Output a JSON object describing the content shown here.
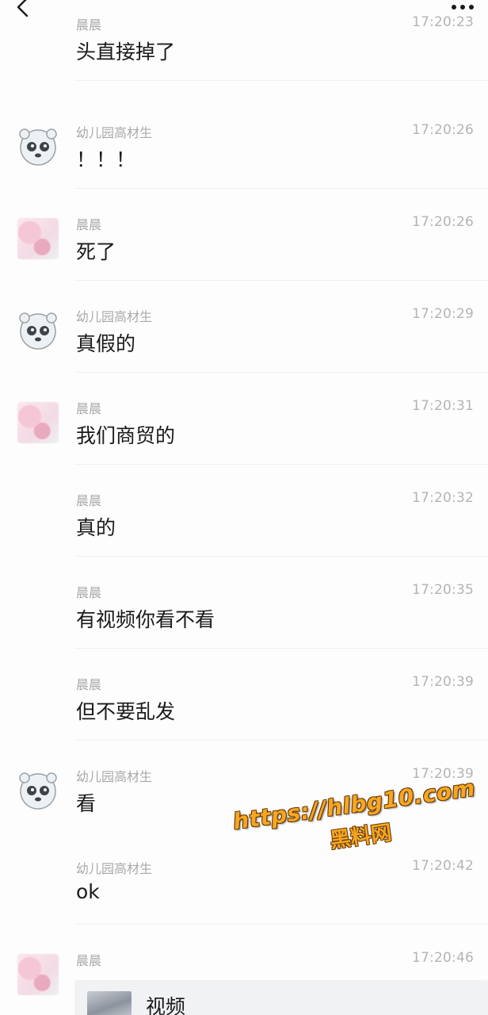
{
  "messages": [
    {
      "sender": "晨晨",
      "time": "17:20:23",
      "text": "头直接掉了",
      "avatar": "none"
    },
    {
      "sender": "幼儿园高材生",
      "time": "17:20:26",
      "text": "！！！",
      "avatar": "panda-avatar"
    },
    {
      "sender": "晨晨",
      "time": "17:20:26",
      "text": "死了",
      "avatar": "pink-avatar"
    },
    {
      "sender": "幼儿园高材生",
      "time": "17:20:29",
      "text": "真假的",
      "avatar": "panda-avatar"
    },
    {
      "sender": "晨晨",
      "time": "17:20:31",
      "text": "我们商贸的",
      "avatar": "pink-avatar"
    },
    {
      "sender": "晨晨",
      "time": "17:20:32",
      "text": "真的",
      "avatar": "none"
    },
    {
      "sender": "晨晨",
      "time": "17:20:35",
      "text": "有视频你看不看",
      "avatar": "none"
    },
    {
      "sender": "晨晨",
      "time": "17:20:39",
      "text": "但不要乱发",
      "avatar": "none"
    },
    {
      "sender": "幼儿园高材生",
      "time": "17:20:39",
      "text": "看",
      "avatar": "panda-avatar"
    },
    {
      "sender": "幼儿园高材生",
      "time": "17:20:42",
      "text": "ok",
      "avatar": "none"
    },
    {
      "sender": "晨晨",
      "time": "17:20:46",
      "text": "",
      "avatar": "pink-avatar"
    }
  ],
  "video_card": {
    "label": "视频"
  },
  "watermark": {
    "url": "https://hlbg10.com",
    "name": "黑料网"
  },
  "icons": {
    "back": "chevron-left-icon",
    "more": "more-horizontal-icon"
  }
}
